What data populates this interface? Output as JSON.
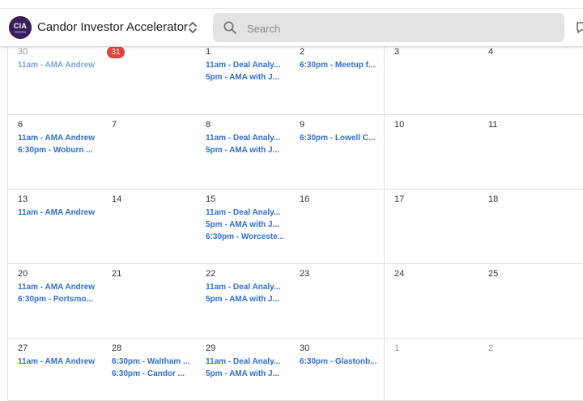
{
  "header": {
    "logo_text": "CIA",
    "group_name": "Candor Investor Accelerator",
    "search_placeholder": "Search"
  },
  "calendar": {
    "weeks": [
      {
        "days": [
          {
            "num": "30",
            "muted": true,
            "events": [
              "11am - AMA Andrew"
            ]
          },
          {
            "num": "31",
            "today": true,
            "events": []
          },
          {
            "num": "1",
            "events": [
              "11am - Deal Analy...",
              "5pm - AMA with J..."
            ]
          },
          {
            "num": "2",
            "events": [
              "6:30pm - Meetup f..."
            ]
          },
          {
            "num": "3",
            "events": []
          },
          {
            "num": "4",
            "events": []
          }
        ]
      },
      {
        "days": [
          {
            "num": "6",
            "events": [
              "11am - AMA Andrew",
              "6:30pm - Woburn ..."
            ]
          },
          {
            "num": "7",
            "events": []
          },
          {
            "num": "8",
            "events": [
              "11am - Deal Analy...",
              "5pm - AMA with J..."
            ]
          },
          {
            "num": "9",
            "events": [
              "6:30pm - Lowell C..."
            ]
          },
          {
            "num": "10",
            "events": []
          },
          {
            "num": "11",
            "events": []
          }
        ]
      },
      {
        "days": [
          {
            "num": "13",
            "events": [
              "11am - AMA Andrew"
            ]
          },
          {
            "num": "14",
            "events": []
          },
          {
            "num": "15",
            "events": [
              "11am - Deal Analy...",
              "5pm - AMA with J...",
              "6:30pm - Worceste..."
            ]
          },
          {
            "num": "16",
            "events": []
          },
          {
            "num": "17",
            "events": []
          },
          {
            "num": "18",
            "events": []
          }
        ]
      },
      {
        "days": [
          {
            "num": "20",
            "events": [
              "11am - AMA Andrew",
              "6:30pm - Portsmo..."
            ]
          },
          {
            "num": "21",
            "events": []
          },
          {
            "num": "22",
            "events": [
              "11am - Deal Analy...",
              "5pm - AMA with J..."
            ]
          },
          {
            "num": "23",
            "events": []
          },
          {
            "num": "24",
            "events": []
          },
          {
            "num": "25",
            "events": []
          }
        ]
      },
      {
        "days": [
          {
            "num": "27",
            "events": [
              "11am - AMA Andrew"
            ]
          },
          {
            "num": "28",
            "events": [
              "6:30pm - Waltham ...",
              "6:30pm - Candor ..."
            ]
          },
          {
            "num": "29",
            "events": [
              "11am - Deal Analy...",
              "5pm - AMA with J..."
            ]
          },
          {
            "num": "30",
            "events": [
              "6:30pm - Glastonb..."
            ]
          },
          {
            "num": "1",
            "muted": true,
            "events": []
          },
          {
            "num": "2",
            "muted": true,
            "events": []
          }
        ]
      }
    ]
  }
}
